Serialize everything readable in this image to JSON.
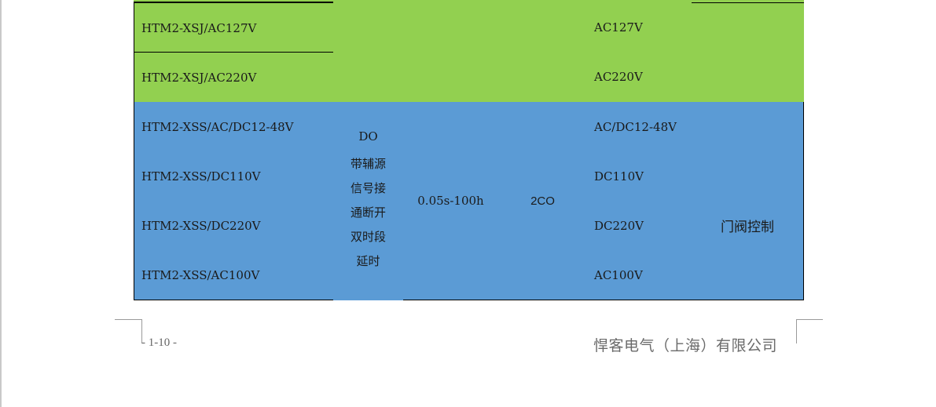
{
  "table": {
    "green_rows": [
      {
        "model": "HTM2-XSJ/AC127V",
        "voltage": "AC127V"
      },
      {
        "model": "HTM2-XSJ/AC220V",
        "voltage": "AC220V"
      }
    ],
    "blue_rows": [
      {
        "model": "HTM2-XSS/AC/DC12-48V",
        "voltage": "AC/DC12-48V"
      },
      {
        "model": "HTM2-XSS/DC110V",
        "voltage": "DC110V"
      },
      {
        "model": "HTM2-XSS/DC220V",
        "voltage": "DC220V"
      },
      {
        "model": "HTM2-XSS/AC100V",
        "voltage": "AC100V"
      }
    ],
    "function_code": "DO",
    "function_lines": [
      "带辅源",
      "信号接",
      "通断开",
      "双时段",
      "延时"
    ],
    "time_range": "0.05s-100h",
    "contacts": "2CO",
    "application": "门阀控制"
  },
  "footer": {
    "page_number": "- 1-10 -",
    "company": "悍客电气（上海）有限公司"
  },
  "colors": {
    "green_fill": "#92d050",
    "blue_fill": "#5b9bd5"
  }
}
